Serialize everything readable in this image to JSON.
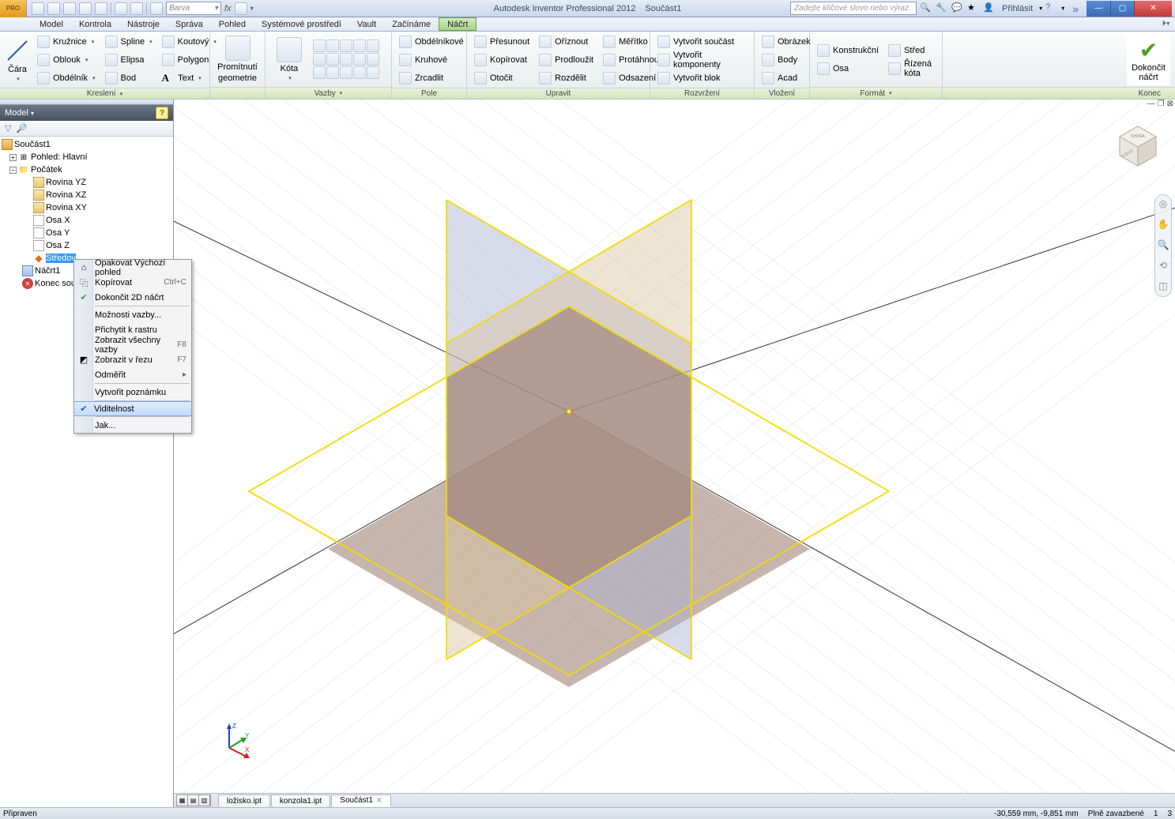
{
  "titlebar": {
    "logo_text": "PRO",
    "style_combo": "Barva",
    "app_title": "Autodesk Inventor Professional 2012",
    "doc_title": "Součást1",
    "search_placeholder": "Zadejte klíčové slovo nebo výraz.",
    "signin": "Přihlásit",
    "overflow": "»"
  },
  "menubar": {
    "items": [
      "Model",
      "Kontrola",
      "Nástroje",
      "Správa",
      "Pohled",
      "Systémové prostředí",
      "Vault",
      "Začínáme",
      "Náčrt"
    ],
    "active_index": 8
  },
  "ribbon": {
    "panels": {
      "draw": {
        "label": "Kreslení",
        "line": "Čára",
        "circle": "Kružnice",
        "arc": "Oblouk",
        "rect": "Obdélník",
        "spline": "Spline",
        "ellipse": "Elipsa",
        "point": "Bod",
        "fillet": "Koutový",
        "polygon": "Polygon",
        "text": "Text"
      },
      "project": {
        "label1": "Promítnutí",
        "label2": "geometrie"
      },
      "dimension": {
        "label": "Kóta",
        "panel_label": "Vazby"
      },
      "pattern": {
        "panel_label": "Pole",
        "rect": "Obdélníkové",
        "circ": "Kruhové",
        "mirror": "Zrcadlit"
      },
      "modify": {
        "panel_label": "Upravit",
        "move": "Přesunout",
        "copy": "Kopírovat",
        "rotate": "Otočit",
        "trim": "Oříznout",
        "extend": "Prodloužit",
        "split": "Rozdělit",
        "scale": "Měřítko",
        "stretch": "Protáhnout",
        "offset": "Odsazení"
      },
      "layout": {
        "panel_label": "Rozvržení",
        "make_part": "Vytvořit součást",
        "make_comp": "Vytvořit komponenty",
        "make_block": "Vytvořit blok"
      },
      "insert": {
        "panel_label": "Vložení",
        "image": "Obrázek",
        "points": "Body",
        "acad": "Acad"
      },
      "format": {
        "panel_label": "Formát",
        "construction": "Konstrukční",
        "axis": "Osa",
        "center": "Střed",
        "driven": "Řízená kóta"
      },
      "finish": {
        "panel_label": "Konec",
        "line1": "Dokončit",
        "line2": "náčrt"
      }
    }
  },
  "browser": {
    "title": "Model",
    "root": "Součást1",
    "view": "Pohled: Hlavní",
    "origin": "Počátek",
    "planes": [
      "Rovina YZ",
      "Rovina XZ",
      "Rovina XY"
    ],
    "axes": [
      "Osa X",
      "Osa Y",
      "Osa Z"
    ],
    "point": "Středov",
    "sketch": "Náčrt1",
    "end": "Konec souč"
  },
  "context_menu": {
    "items": [
      {
        "label": "Opakovat Výchozí pohled",
        "icon": "home"
      },
      {
        "label": "Kopírovat",
        "icon": "copy",
        "shortcut": "Ctrl+C"
      },
      {
        "label": "Dokončit 2D náčrt",
        "icon": "check"
      },
      {
        "sep": true
      },
      {
        "label": "Možnosti vazby..."
      },
      {
        "label": "Přichytit k rastru"
      },
      {
        "label": "Zobrazit všechny vazby",
        "shortcut": "F8"
      },
      {
        "label": "Zobrazit v řezu",
        "icon": "section",
        "shortcut": "F7"
      },
      {
        "label": "Odměřit",
        "submenu": true
      },
      {
        "sep": true
      },
      {
        "label": "Vytvořit poznámku"
      },
      {
        "sep": true
      },
      {
        "label": "Viditelnost",
        "icon": "check",
        "highlight": true
      },
      {
        "sep": true
      },
      {
        "label": "Jak..."
      }
    ]
  },
  "doctabs": {
    "tabs": [
      "ložisko.ipt",
      "konzola1.ipt",
      "Součást1"
    ],
    "active_index": 2
  },
  "statusbar": {
    "left": "Připraven",
    "coords": "-30,559 mm, -9,851 mm",
    "constraints": "Plně zavazbené",
    "num1": "1",
    "num2": "3"
  }
}
